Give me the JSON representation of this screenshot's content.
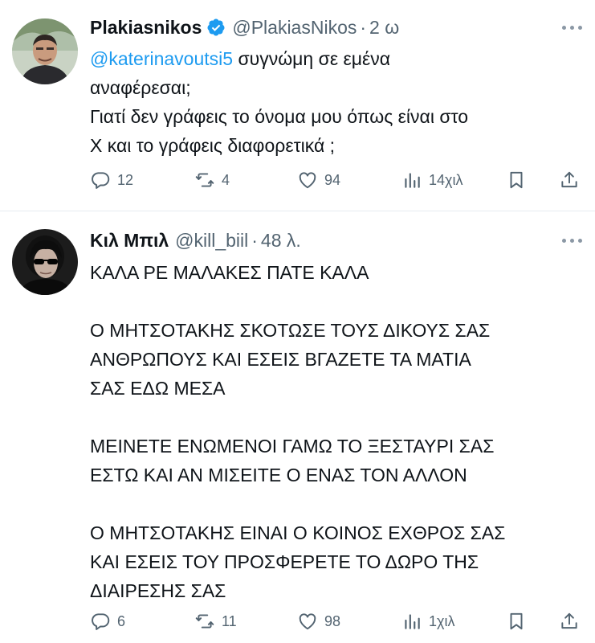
{
  "tweets": [
    {
      "display_name": "Plakiasnikos",
      "handle": "@PlakiasNikos",
      "time": "2 ω",
      "mention": "@katerinavoutsi5",
      "lines": [
        " συγνώμη σε εμένα",
        "αναφέρεσαι;",
        "Γιατί δεν γράφεις το όνομα μου όπως είναι στο",
        "Χ και το γράφεις διαφορετικά ;"
      ],
      "stats": {
        "replies": "12",
        "retweets": "4",
        "likes": "94",
        "views": "14χιλ"
      }
    },
    {
      "display_name": "Κιλ Μπιλ",
      "handle": "@kill_biil",
      "time": "48 λ.",
      "lines": [
        "ΚΑΛΑ ΡΕ ΜΑΛΑΚΕΣ ΠΑΤΕ ΚΑΛΑ",
        "",
        "Ο ΜΗΤΣΟΤΑΚΗΣ ΣΚΟΤΩΣΕ ΤΟΥΣ ΔΙΚΟΥΣ ΣΑΣ",
        "ΑΝΘΡΩΠΟΥΣ ΚΑΙ ΕΣΕΙΣ ΒΓΑΖΕΤΕ ΤΑ ΜΑΤΙΑ",
        "ΣΑΣ ΕΔΩ ΜΕΣΑ",
        "",
        "ΜΕΙΝΕΤΕ ΕΝΩΜΕΝΟΙ ΓΑΜΩ ΤΟ ΞΕΣΤΑΥΡΙ ΣΑΣ",
        "ΕΣΤΩ ΚΑΙ ΑΝ ΜΙΣΕΙΤΕ Ο ΕΝΑΣ ΤΟΝ ΑΛΛΟΝ",
        "",
        "Ο ΜΗΤΣΟΤΑΚΗΣ ΕΙΝΑΙ Ο ΚΟΙΝΟΣ ΕΧΘΡΟΣ ΣΑΣ",
        "ΚΑΙ ΕΣΕΙΣ ΤΟΥ ΠΡΟΣΦΕΡΕΤΕ ΤΟ ΔΩΡΟ ΤΗΣ",
        "ΔΙΑΙΡΕΣΗΣ ΣΑΣ"
      ],
      "stats": {
        "replies": "6",
        "retweets": "11",
        "likes": "98",
        "views": "1χιλ"
      }
    }
  ],
  "dot_separator": "·",
  "colors": {
    "text": "#0f1419",
    "secondary": "#536471",
    "link": "#1d9bf0",
    "verified": "#1d9bf0",
    "divider": "#e6ecf0"
  }
}
